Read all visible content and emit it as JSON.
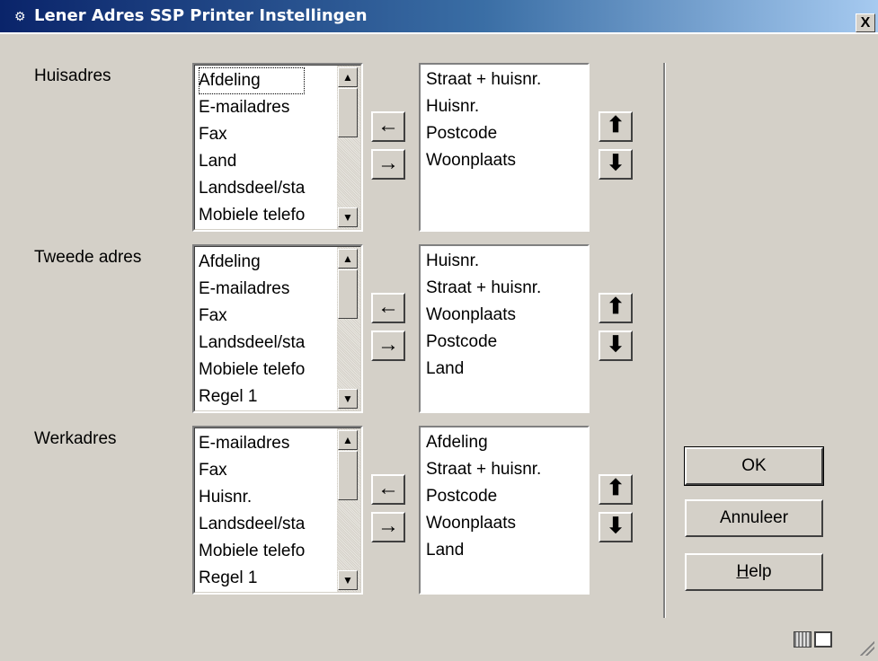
{
  "window": {
    "title": "Lener Adres SSP Printer Instellingen",
    "close_glyph": "X"
  },
  "sections": [
    {
      "label": "Huisadres",
      "available": [
        "Afdeling",
        "E-mailadres",
        "Fax",
        "Land",
        "Landsdeel/sta",
        "Mobiele telefo"
      ],
      "selected": [
        "Straat + huisnr.",
        "Huisnr.",
        "Postcode",
        "Woonplaats"
      ]
    },
    {
      "label": "Tweede adres",
      "available": [
        "Afdeling",
        "E-mailadres",
        "Fax",
        "Landsdeel/sta",
        "Mobiele telefo",
        "Regel 1"
      ],
      "selected": [
        "Huisnr.",
        "Straat + huisnr.",
        "Woonplaats",
        "Postcode",
        "Land"
      ]
    },
    {
      "label": "Werkadres",
      "available": [
        "E-mailadres",
        "Fax",
        "Huisnr.",
        "Landsdeel/sta",
        "Mobiele telefo",
        "Regel 1"
      ],
      "selected": [
        "Afdeling",
        "Straat + huisnr.",
        "Postcode",
        "Woonplaats",
        "Land"
      ]
    }
  ],
  "icons": {
    "add_arrow": "←",
    "remove_arrow": "→",
    "move_up": "⬆",
    "move_down": "⬇",
    "scroll_up": "▲",
    "scroll_down": "▼"
  },
  "buttons": {
    "ok": "OK",
    "cancel": "Annuleer",
    "help_mnemonic": "H",
    "help_rest": "elp"
  }
}
